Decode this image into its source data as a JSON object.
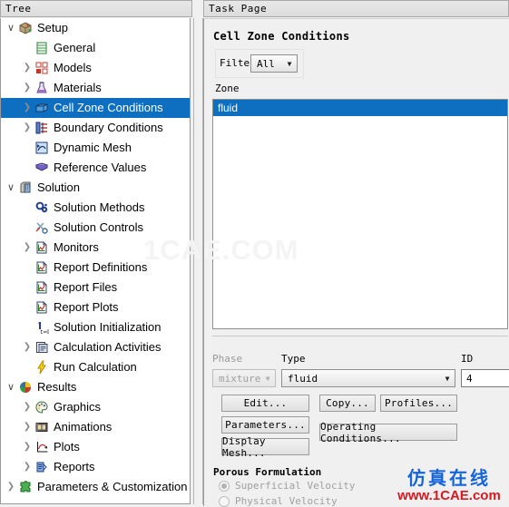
{
  "tree": {
    "header": "Tree",
    "items": [
      {
        "label": "Setup",
        "depth": 0,
        "twisty": "down",
        "icon": "setup-box-icon"
      },
      {
        "label": "General",
        "depth": 1,
        "twisty": "none",
        "icon": "general-grid-icon"
      },
      {
        "label": "Models",
        "depth": 1,
        "twisty": "right",
        "icon": "models-icon"
      },
      {
        "label": "Materials",
        "depth": 1,
        "twisty": "right",
        "icon": "materials-flask-icon"
      },
      {
        "label": "Cell Zone Conditions",
        "depth": 1,
        "twisty": "right",
        "icon": "cell-zone-icon",
        "selected": true
      },
      {
        "label": "Boundary Conditions",
        "depth": 1,
        "twisty": "right",
        "icon": "boundary-conditions-icon"
      },
      {
        "label": "Dynamic Mesh",
        "depth": 1,
        "twisty": "none",
        "icon": "dynamic-mesh-icon"
      },
      {
        "label": "Reference Values",
        "depth": 1,
        "twisty": "none",
        "icon": "reference-values-book-icon"
      },
      {
        "label": "Solution",
        "depth": 0,
        "twisty": "down",
        "icon": "solution-building-icon"
      },
      {
        "label": "Solution Methods",
        "depth": 1,
        "twisty": "none",
        "icon": "solution-methods-icon"
      },
      {
        "label": "Solution Controls",
        "depth": 1,
        "twisty": "none",
        "icon": "solution-controls-tools-icon"
      },
      {
        "label": "Monitors",
        "depth": 1,
        "twisty": "right",
        "icon": "monitors-chart-icon"
      },
      {
        "label": "Report Definitions",
        "depth": 1,
        "twisty": "none",
        "icon": "report-definitions-icon"
      },
      {
        "label": "Report Files",
        "depth": 1,
        "twisty": "none",
        "icon": "report-files-icon"
      },
      {
        "label": "Report Plots",
        "depth": 1,
        "twisty": "none",
        "icon": "report-plots-icon"
      },
      {
        "label": "Solution Initialization",
        "depth": 1,
        "twisty": "none",
        "icon": "solution-initialization-icon"
      },
      {
        "label": "Calculation Activities",
        "depth": 1,
        "twisty": "right",
        "icon": "calculation-activities-icon"
      },
      {
        "label": "Run Calculation",
        "depth": 1,
        "twisty": "none",
        "icon": "run-calculation-lightning-icon"
      },
      {
        "label": "Results",
        "depth": 0,
        "twisty": "down",
        "icon": "results-cube-icon"
      },
      {
        "label": "Graphics",
        "depth": 1,
        "twisty": "right",
        "icon": "graphics-palette-icon"
      },
      {
        "label": "Animations",
        "depth": 1,
        "twisty": "right",
        "icon": "animations-film-icon"
      },
      {
        "label": "Plots",
        "depth": 1,
        "twisty": "right",
        "icon": "plots-curve-icon"
      },
      {
        "label": "Reports",
        "depth": 1,
        "twisty": "right",
        "icon": "reports-icon"
      },
      {
        "label": "Parameters & Customization",
        "depth": 0,
        "twisty": "right",
        "icon": "parameters-puzzle-icon"
      }
    ]
  },
  "task_page": {
    "header": "Task Page",
    "title": "Cell Zone Conditions",
    "filter": {
      "label": "Filter",
      "value": "All"
    },
    "zone": {
      "label": "Zone",
      "items": [
        {
          "name": "fluid",
          "selected": true
        }
      ]
    },
    "phase": {
      "label": "Phase",
      "value": "mixture",
      "disabled": true
    },
    "type": {
      "label": "Type",
      "value": "fluid"
    },
    "id": {
      "label": "ID",
      "value": "4"
    },
    "buttons": {
      "edit": "Edit...",
      "parameters": "Parameters...",
      "display_mesh": "Display Mesh...",
      "copy": "Copy...",
      "profiles": "Profiles...",
      "operating_conditions": "Operating Conditions..."
    },
    "porous": {
      "title": "Porous Formulation",
      "options": [
        {
          "label": "Superficial Velocity",
          "selected": true
        },
        {
          "label": "Physical Velocity",
          "selected": false
        }
      ]
    }
  },
  "watermarks": {
    "center": "1CAE.COM",
    "logo_cn": "仿真在线",
    "logo_en": "www.1CAE.com"
  },
  "colors": {
    "selection_blue": "#0e6fc0",
    "panel_bg": "#f0f0f0",
    "logo_blue": "#1565d8",
    "logo_red": "#d71920"
  }
}
